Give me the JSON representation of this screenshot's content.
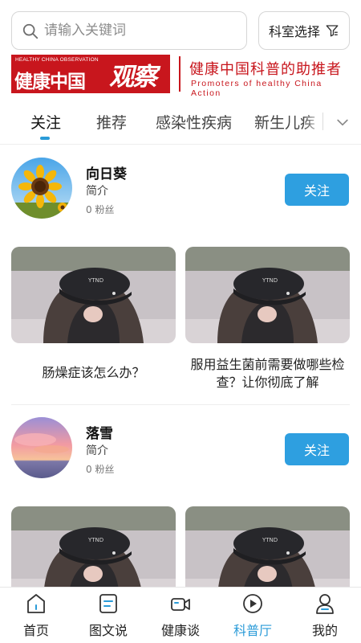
{
  "search": {
    "placeholder": "请输入关键词"
  },
  "department_button": {
    "label": "科室选择"
  },
  "banner": {
    "small_en": "HEALTHY CHINA OBSERVATION",
    "title": "健康中国",
    "big": "观察",
    "slogan": "健康中国科普的助推者",
    "slogan_en": "Promoters of healthy China Action"
  },
  "tabs": [
    {
      "label": "关注",
      "active": true
    },
    {
      "label": "推荐",
      "active": false
    },
    {
      "label": "感染性疾病",
      "active": false
    },
    {
      "label": "新生儿疾",
      "active": false
    }
  ],
  "authors": [
    {
      "name": "向日葵",
      "intro": "简介",
      "fans": "0 粉丝",
      "follow_label": "关注",
      "articles": [
        {
          "title": "肠燥症该怎么办？"
        },
        {
          "title": "服用益生菌前需要做哪些检查？让你彻底了解"
        }
      ]
    },
    {
      "name": "落雪",
      "intro": "简介",
      "fans": "0 粉丝",
      "follow_label": "关注",
      "articles": [
        {
          "title": ""
        },
        {
          "title": ""
        }
      ]
    }
  ],
  "bottom_nav": [
    {
      "label": "首页",
      "icon": "home-icon",
      "active": false
    },
    {
      "label": "图文说",
      "icon": "document-icon",
      "active": false
    },
    {
      "label": "健康谈",
      "icon": "video-camera-icon",
      "active": false
    },
    {
      "label": "科普厅",
      "icon": "play-circle-icon",
      "active": true
    },
    {
      "label": "我的",
      "icon": "person-icon",
      "active": false
    }
  ],
  "colors": {
    "accent": "#2a9bd8",
    "follow_button": "#2e9fe0",
    "brand_red": "#c8161d"
  }
}
